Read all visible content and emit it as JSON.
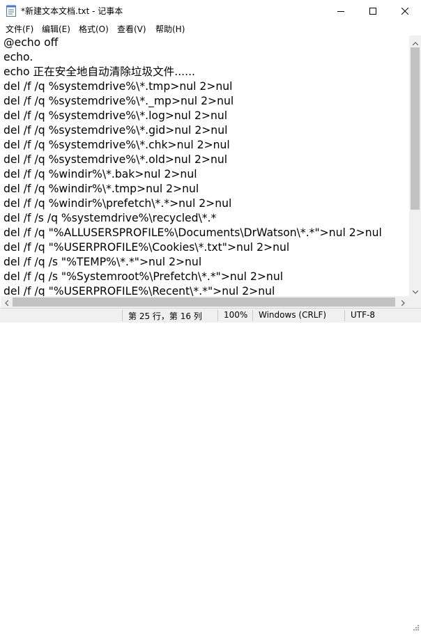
{
  "window": {
    "title": "*新建文本文档.txt - 记事本",
    "icon": "notepad-icon"
  },
  "controls": {
    "minimize_icon": "minimize-icon",
    "maximize_icon": "maximize-icon",
    "close_icon": "close-icon"
  },
  "menu": {
    "items": [
      {
        "label": "文件(F)"
      },
      {
        "label": "编辑(E)"
      },
      {
        "label": "格式(O)"
      },
      {
        "label": "查看(V)"
      },
      {
        "label": "帮助(H)"
      }
    ]
  },
  "editor": {
    "lines": [
      "@echo off",
      "echo.",
      "echo 正在安全地自动清除垃圾文件......",
      "del /f /q %systemdrive%\\*.tmp>nul 2>nul",
      "del /f /q %systemdrive%\\*._mp>nul 2>nul",
      "del /f /q %systemdrive%\\*.log>nul 2>nul",
      "del /f /q %systemdrive%\\*.gid>nul 2>nul",
      "del /f /q %systemdrive%\\*.chk>nul 2>nul",
      "del /f /q %systemdrive%\\*.old>nul 2>nul",
      "del /f /q %windir%\\*.bak>nul 2>nul",
      "del /f /q %windir%\\*.tmp>nul 2>nul",
      "del /f /q %windir%\\prefetch\\*.*>nul 2>nul",
      "del /f /s /q %systemdrive%\\recycled\\*.*",
      "del /f /q \"%ALLUSERSPROFILE%\\Documents\\DrWatson\\*.*\">nul 2>nul",
      "del /f /q \"%USERPROFILE%\\Cookies\\*.txt\">nul 2>nul",
      "del /f /q /s \"%TEMP%\\*.*\">nul 2>nul",
      "del /f /q /s \"%Systemroot%\\Prefetch\\*.*\">nul 2>nul",
      "del /f /q \"%USERPROFILE%\\Recent\\*.*\">nul 2>nul"
    ]
  },
  "status": {
    "position": "第 25 行，第 16 列",
    "zoom": "100%",
    "line_ending": "Windows (CRLF)",
    "encoding": "UTF-8"
  }
}
